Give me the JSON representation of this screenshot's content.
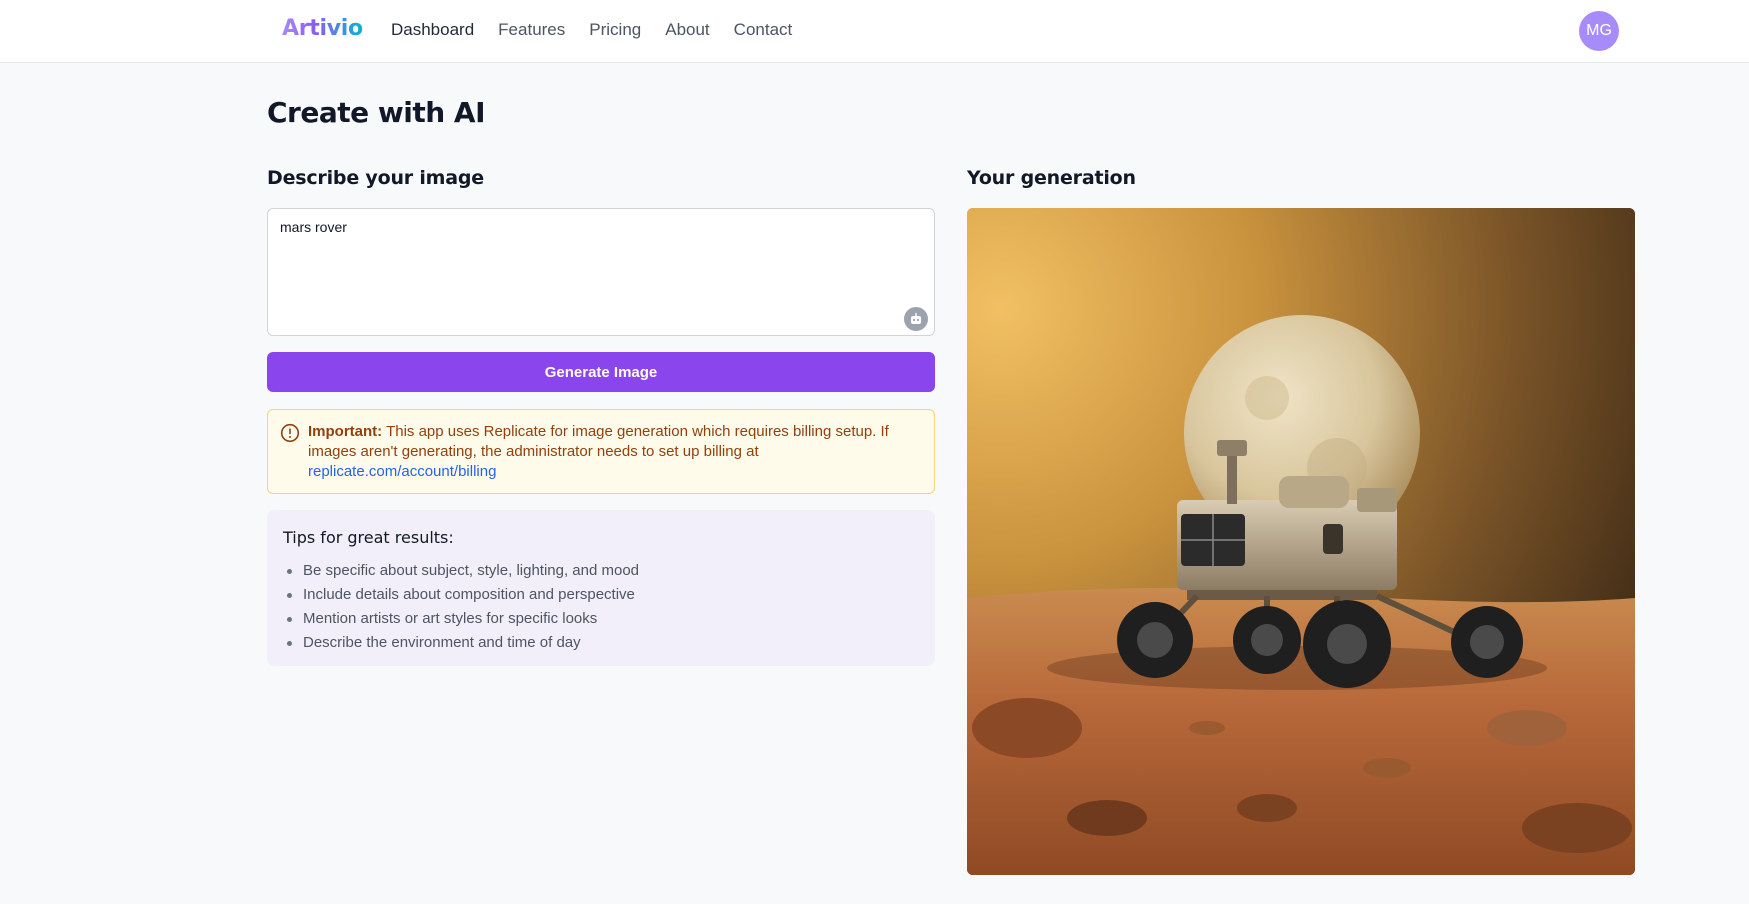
{
  "header": {
    "logo": "Artivio",
    "nav": [
      {
        "label": "Dashboard",
        "active": true
      },
      {
        "label": "Features"
      },
      {
        "label": "Pricing"
      },
      {
        "label": "About"
      },
      {
        "label": "Contact"
      }
    ],
    "avatar_initials": "MG"
  },
  "main": {
    "title": "Create with AI",
    "describe_heading": "Describe your image",
    "prompt_value": "mars rover",
    "generate_label": "Generate Image",
    "warning": {
      "strong": "Important:",
      "text": "This app uses Replicate for image generation which requires billing setup. If images aren't generating, the administrator needs to set up billing at",
      "link": "replicate.com/account/billing"
    },
    "tips": {
      "title": "Tips for great results:",
      "items": [
        "Be specific about subject, style, lighting, and mood",
        "Include details about composition and perspective",
        "Mention artists or art styles for specific looks",
        "Describe the environment and time of day"
      ]
    },
    "generation_heading": "Your generation"
  },
  "colors": {
    "accent": "#8b45ec",
    "avatar": "#a78bfa",
    "warning_bg": "#fefbea",
    "warning_text": "#92400e",
    "link": "#2563eb",
    "tips_bg": "#f3effa"
  }
}
